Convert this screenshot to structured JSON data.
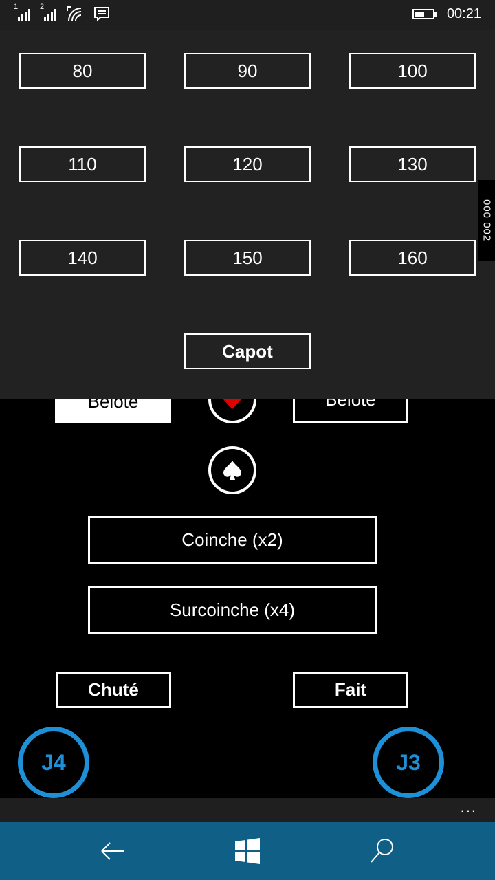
{
  "status": {
    "sim1_num": "1",
    "sim2_num": "2",
    "time": "00:21",
    "battery_fraction": 0.55,
    "icons": [
      "signal-icon",
      "signal-icon",
      "wifi-icon",
      "message-icon",
      "battery-icon"
    ]
  },
  "bids": {
    "row1": [
      "80",
      "90",
      "100"
    ],
    "row2": [
      "110",
      "120",
      "130"
    ],
    "row3": [
      "140",
      "150",
      "160"
    ],
    "capot": "Capot"
  },
  "side_tab": {
    "text": "000 002"
  },
  "game": {
    "belote_left": "Belote",
    "belote_right": "Belote",
    "coinche": "Coinche (x2)",
    "surcoinche": "Surcoinche (x4)",
    "chute": "Chuté",
    "fait": "Fait",
    "player_left": "J4",
    "player_right": "J3",
    "suit_icons": [
      "heart-icon",
      "spade-icon"
    ]
  },
  "appbar": {
    "more": "..."
  },
  "nav": {
    "icons": [
      "back-arrow-icon",
      "windows-icon",
      "search-icon"
    ]
  },
  "colors": {
    "accent": "#1e90d8",
    "navbar": "#0f5f86",
    "overlay": "#222222",
    "heart": "#e00000"
  }
}
